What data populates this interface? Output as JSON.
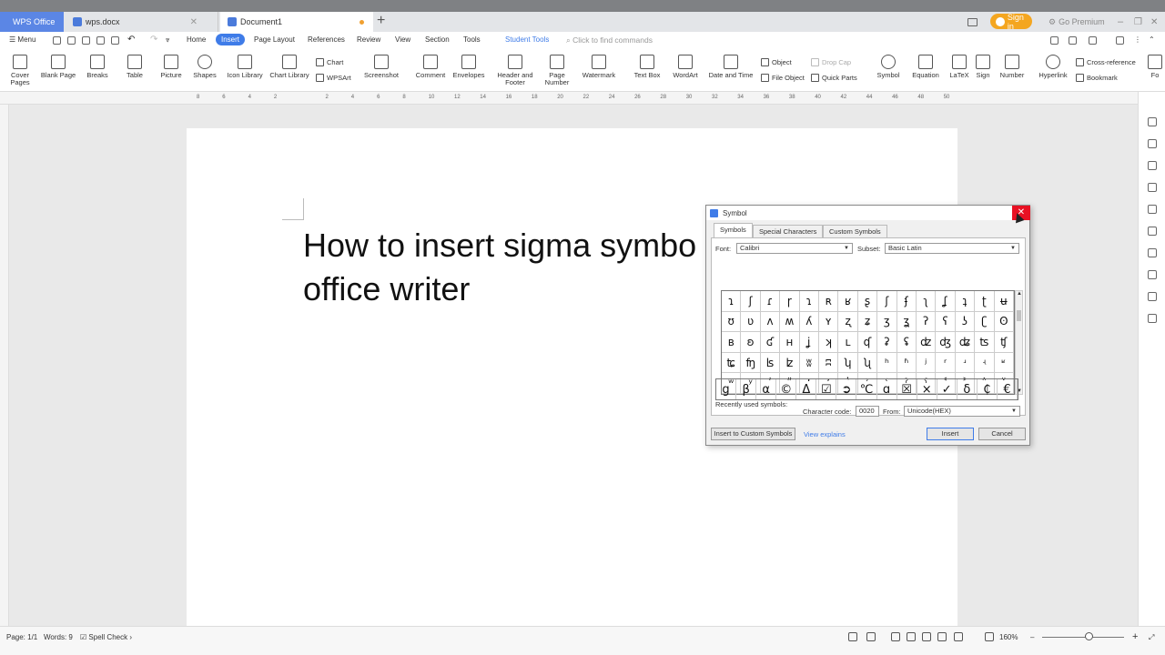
{
  "tabs": {
    "app": "WPS Office",
    "doc1": "wps.docx",
    "active": "Document1",
    "add": "+"
  },
  "topbar": {
    "sign_in": "Sign in",
    "go_premium": "Go Premium"
  },
  "menu": {
    "menu_label": "Menu",
    "items": [
      "Home",
      "Insert",
      "Page Layout",
      "References",
      "Review",
      "View",
      "Section",
      "Tools"
    ],
    "student_tools": "Student Tools",
    "find_placeholder": "Click to find commands"
  },
  "ribbon": {
    "cover_pages": "Cover Pages",
    "blank_page": "Blank Page",
    "breaks": "Breaks",
    "table": "Table",
    "picture": "Picture",
    "shapes": "Shapes",
    "icon_library": "Icon Library",
    "chart_library": "Chart Library",
    "chart": "Chart",
    "wpsart": "WPSArt",
    "screenshot": "Screenshot",
    "comment": "Comment",
    "envelopes": "Envelopes",
    "header_footer": "Header and Footer",
    "page_number": "Page Number",
    "watermark": "Watermark",
    "text_box": "Text Box",
    "wordart": "WordArt",
    "date_time": "Date and Time",
    "object": "Object",
    "file_object": "File Object",
    "drop_cap": "Drop Cap",
    "quick_parts": "Quick Parts",
    "symbol": "Symbol",
    "equation": "Equation",
    "latex": "LaTeX",
    "sign": "Sign",
    "number": "Number",
    "hyperlink": "Hyperlink",
    "cross_reference": "Cross-reference",
    "bookmark": "Bookmark",
    "fo": "Fo"
  },
  "ruler_numbers": [
    "8",
    "6",
    "4",
    "2",
    "",
    "2",
    "4",
    "6",
    "8",
    "10",
    "12",
    "14",
    "16",
    "18",
    "20",
    "22",
    "24",
    "26",
    "28",
    "30",
    "32",
    "34",
    "36",
    "38",
    "40",
    "42",
    "44",
    "46",
    "48",
    "50"
  ],
  "document": {
    "line1": "How to insert sigma symbo",
    "line2": "office writer"
  },
  "status": {
    "page": "Page: 1/1",
    "words": "Words: 9",
    "spell_check": "Spell Check",
    "zoom": "160%"
  },
  "dialog": {
    "title": "Symbol",
    "close": "✕",
    "tabs": [
      "Symbols",
      "Special Characters",
      "Custom Symbols"
    ],
    "font_label": "Font:",
    "font_value": "Calibri",
    "subset_label": "Subset:",
    "subset_value": "Basic Latin",
    "symbols": [
      "ɿ",
      "ʃ",
      "ɾ",
      "ɼ",
      "ɿ",
      "ʀ",
      "ʁ",
      "ʂ",
      "ʃ",
      "ʄ",
      "ʅ",
      "ʆ",
      "ʇ",
      "ʈ",
      "ʉ",
      "ʊ",
      "ʋ",
      "ʌ",
      "ʍ",
      "ʎ",
      "ʏ",
      "ʐ",
      "ʑ",
      "ʒ",
      "ʓ",
      "ʔ",
      "ʕ",
      "ʖ",
      "ʗ",
      "ʘ",
      "ʙ",
      "ʚ",
      "ʛ",
      "ʜ",
      "ʝ",
      "ʞ",
      "ʟ",
      "ʠ",
      "ʡ",
      "ʢ",
      "ʣ",
      "ʤ",
      "ʥ",
      "ʦ",
      "ʧ",
      "ʨ",
      "ʩ",
      "ʪ",
      "ʫ",
      "ʬ",
      "ʭ",
      "ʮ",
      "ʯ",
      "ʰ",
      "ʱ",
      "ʲ",
      "ʳ",
      "ʴ",
      "ʵ",
      "ʶ",
      "ʷ",
      "ʸ",
      "ʹ",
      "ʺ",
      "ʻ",
      "ʼ",
      "ʽ",
      "ʾ",
      "ʿ",
      "ˀ",
      "ˁ",
      "˂",
      "˃",
      "˄",
      "˅"
    ],
    "recent_label": "Recently used symbols:",
    "recent": [
      "g",
      "β",
      "α",
      "©",
      "Δ",
      "☑",
      "➲",
      "℃",
      "ɑ",
      "☒",
      "×",
      "✓",
      "δ",
      "₵",
      "€"
    ],
    "char_code_label": "Character code:",
    "char_code_value": "0020",
    "from_label": "From:",
    "from_value": "Unicode(HEX)",
    "insert_custom": "Insert to Custom Symbols",
    "view_explains": "View explains",
    "insert": "Insert",
    "cancel": "Cancel"
  }
}
